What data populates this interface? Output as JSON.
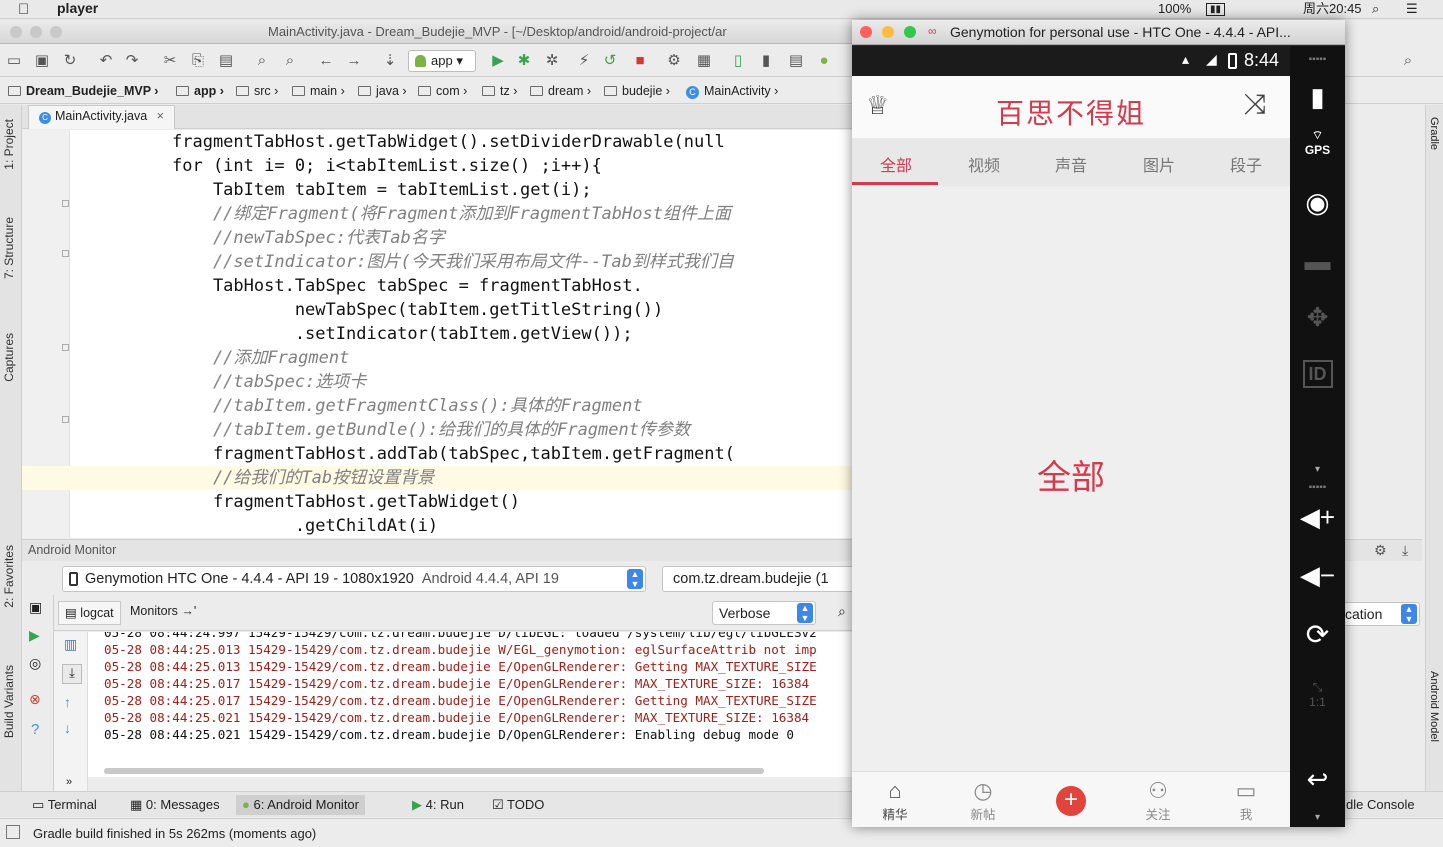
{
  "menubar": {
    "app_name": "player",
    "battery": "100%",
    "clock": "周六20:45"
  },
  "ide": {
    "title": "MainActivity.java - Dream_Budejie_MVP - [~/Desktop/android/android-project/ar",
    "run_config": "app",
    "breadcrumb": [
      "Dream_Budejie_MVP",
      "app",
      "src",
      "main",
      "java",
      "com",
      "tz",
      "dream",
      "budejie",
      "MainActivity"
    ],
    "editor_tab": "MainActivity.java",
    "left_tabs": [
      "1: Project",
      "7: Structure",
      "Captures",
      "2: Favorites",
      "Build Variants"
    ],
    "right_tabs": [
      "Gradle",
      "Android Model"
    ],
    "code": [
      "fragmentTabHost.getTabWidget().setDividerDrawable(null",
      "for (int i= 0; i<tabItemList.size() ;i++){",
      "    TabItem tabItem = tabItemList.get(i);",
      "    //绑定Fragment(将Fragment添加到FragmentTabHost组件上面",
      "    //newTabSpec:代表Tab名字",
      "    //setIndicator:图片(今天我们采用布局文件--Tab到样式我们自",
      "    TabHost.TabSpec tabSpec = fragmentTabHost.",
      "            newTabSpec(tabItem.getTitleString())",
      "            .setIndicator(tabItem.getView());",
      "    //添加Fragment",
      "    //tabSpec:选项卡",
      "    //tabItem.getFragmentClass():具体的Fragment",
      "    //tabItem.getBundle():给我们的具体的Fragment传参数",
      "    fragmentTabHost.addTab(tabSpec,tabItem.getFragment(",
      "    //给我们的Tab按钮设置背景",
      "    fragmentTabHost.getTabWidget()",
      "            .getChildAt(i)"
    ],
    "monitor": {
      "header": "Android Monitor",
      "device": "Genymotion HTC One - 4.4.4 - API 19 - 1080x1920",
      "device_detail": "Android 4.4.4, API 19",
      "process": "com.tz.dream.budejie (1",
      "tabs": [
        "logcat",
        "Monitors"
      ],
      "log_level": "Verbose",
      "filter": "cation",
      "logs": [
        {
          "text": "05-28 08:44:24.997 15429-15429/com.tz.dream.budejie D/libEGL: loaded /system/lib/egl/libGLESv2",
          "level": "D"
        },
        {
          "text": "05-28 08:44:25.013 15429-15429/com.tz.dream.budejie W/EGL_genymotion: eglSurfaceAttrib not imp",
          "level": "E"
        },
        {
          "text": "05-28 08:44:25.013 15429-15429/com.tz.dream.budejie E/OpenGLRenderer: Getting MAX_TEXTURE_SIZE",
          "level": "E"
        },
        {
          "text": "05-28 08:44:25.017 15429-15429/com.tz.dream.budejie E/OpenGLRenderer: MAX_TEXTURE_SIZE: 16384",
          "level": "E"
        },
        {
          "text": "05-28 08:44:25.017 15429-15429/com.tz.dream.budejie E/OpenGLRenderer: Getting MAX_TEXTURE_SIZE",
          "level": "E"
        },
        {
          "text": "05-28 08:44:25.021 15429-15429/com.tz.dream.budejie E/OpenGLRenderer: MAX_TEXTURE_SIZE: 16384",
          "level": "E"
        },
        {
          "text": "05-28 08:44:25.021 15429-15429/com.tz.dream.budejie D/OpenGLRenderer: Enabling debug mode 0",
          "level": "D"
        }
      ]
    },
    "bottom_tools": {
      "terminal": "Terminal",
      "messages": "0: Messages",
      "android_monitor": "6: Android Monitor",
      "run": "4: Run",
      "todo": "TODO",
      "gradle_console": "dle Console"
    },
    "status": "Gradle build finished in 5s 262ms (moments ago)"
  },
  "genymotion": {
    "title": "Genymotion for personal use - HTC One - 4.4.4 - API...",
    "time": "8:44",
    "app_title": "百思不得姐",
    "tabs": [
      "全部",
      "视频",
      "声音",
      "图片",
      "段子"
    ],
    "content_label": "全部",
    "nav": [
      "精华",
      "新帖",
      "",
      "关注",
      "我"
    ],
    "sidebar": {
      "gps": "GPS",
      "id": "ID",
      "ratio": "1:1"
    }
  },
  "colors": {
    "accent": "#d33a4c",
    "mac_red": "#fc605c",
    "mac_yellow": "#fdbc40",
    "mac_green": "#34c84a"
  }
}
